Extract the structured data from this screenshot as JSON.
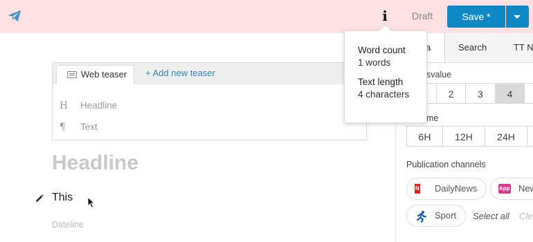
{
  "topbar": {
    "draft_label": "Draft",
    "save_label": "Save *",
    "bg_color": "#fde1e1",
    "accent_color": "#1088c8",
    "info_glyph": "i"
  },
  "popover": {
    "word_count_title": "Word count",
    "word_count_value": "1 words",
    "text_length_title": "Text length",
    "text_length_value": "4 characters"
  },
  "right_panel": {
    "tabs": [
      "a",
      "Search",
      "TT N"
    ],
    "value_label": "svalue",
    "value_options": [
      "2",
      "3",
      "4"
    ],
    "value_selected": "4",
    "time_label": "me",
    "time_options": [
      "6H",
      "12H",
      "24H"
    ],
    "channels_label": "Publication channels",
    "channels": [
      {
        "name": "DailyNews",
        "icon": "dailynews-icon",
        "badge": "N"
      },
      {
        "name": "New",
        "icon": "app-icon",
        "badge": "App"
      },
      {
        "name": "Sport",
        "icon": "runner-icon",
        "badge": ""
      }
    ],
    "select_all": "Select all",
    "clear": "Clea"
  },
  "teaser": {
    "tab_label": "Web teaser",
    "add_label": "+ Add new teaser",
    "headline_placeholder": "Headline",
    "text_placeholder": "Text",
    "headline_glyph": "H",
    "text_glyph": "¶"
  },
  "editor": {
    "headline": "Headline",
    "body": "This",
    "dateline": "Dateline"
  }
}
